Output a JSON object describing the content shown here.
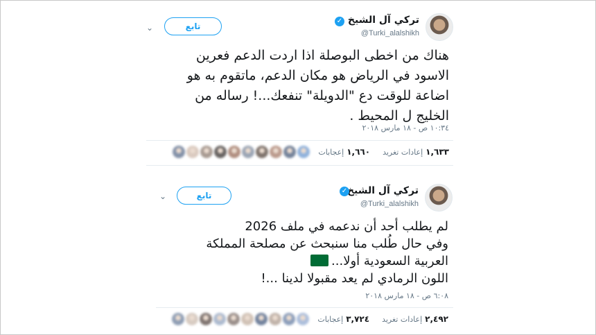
{
  "tweets": [
    {
      "name": "تركي آل الشيخ",
      "handle": "@Turki_alalshikh",
      "follow_label": "تابع",
      "lines": [
        "هناك من اخطى البوصلة اذا اردت الدعم فعرين",
        "الاسود في الرياض هو مكان الدعم، ماتقوم به هو",
        "اضاعة للوقت دع \"الدويلة\" تنفعك...! رساله من",
        "الخليج ل المحيط ."
      ],
      "timestamp": "١٠:٣٤ ص - ١٨ مارس ٢٠١٨",
      "retweets": "١,٦٣٣",
      "retweets_label": "إعادات تغريد",
      "likes": "١,٦٦٠",
      "likes_label": "إعجابات",
      "face_colors": [
        "#7fa6d6",
        "#5e6f8a",
        "#b08a7a",
        "#6a5d55",
        "#8a96a8",
        "#a47d6c",
        "#4f4a48",
        "#9a8a80",
        "#d4c1b5",
        "#6f7f9a"
      ]
    },
    {
      "name": "تركي آل الشيخ",
      "handle": "@Turki_alalshikh",
      "follow_label": "تابع",
      "lines": [
        "لم يطلب أحد أن ندعمه في ملف 2026",
        "وفي حال طُلب منا سنبحث عن مصلحة المملكة",
        "العربية السعودية أولا...",
        "اللون الرمادي لم يعد مقبولا لدينا ...!"
      ],
      "flag_emoji": "🇸🇦",
      "timestamp": "٦:٠٨ ص - ١٨ مارس ٢٠١٨",
      "retweets": "٢,٤٩٢",
      "retweets_label": "إعادات تغريد",
      "likes": "٣,٧٢٤",
      "likes_label": "إعجابات",
      "face_colors": [
        "#9fb4d6",
        "#7a8fb0",
        "#b7a79c",
        "#5c6f8e",
        "#c9b8aa",
        "#8a7d78",
        "#a0b0c8",
        "#6c5f5a",
        "#d1c3b8",
        "#7d8ea8"
      ]
    }
  ],
  "icons": {
    "verified": "verified-badge-icon",
    "chevron": "chevron-down-icon"
  },
  "colors": {
    "accent": "#1da1f2",
    "muted": "#657786",
    "text": "#14171a",
    "flag_green": "#006c35"
  }
}
